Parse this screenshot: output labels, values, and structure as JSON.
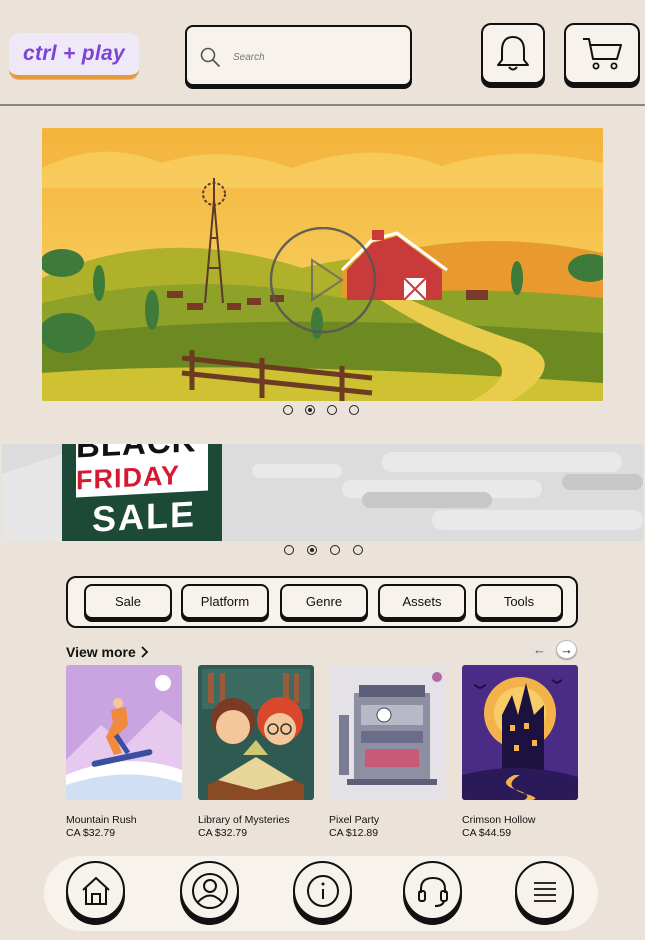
{
  "header": {
    "logo_text": "ctrl + play",
    "search_placeholder": "Search",
    "icons": [
      "search-icon",
      "bell-icon",
      "cart-icon"
    ]
  },
  "hero": {
    "carousel_index": 2,
    "carousel_count": 4,
    "icons": [
      "play-icon"
    ]
  },
  "promo": {
    "line1": "BLACK",
    "line2": "FRIDAY",
    "line3": "SALE",
    "carousel_index": 2,
    "carousel_count": 4
  },
  "filters": [
    "Sale",
    "Platform",
    "Genre",
    "Assets",
    "Tools"
  ],
  "products": {
    "view_more": "View more",
    "items": [
      {
        "name": "Mountain Rush",
        "price": "CA $32.79"
      },
      {
        "name": "Library of Mysteries",
        "price": "CA $32.79"
      },
      {
        "name": "Pixel Party",
        "price": "CA $12.89"
      },
      {
        "name": "Crimson Hollow",
        "price": "CA $44.59"
      }
    ]
  },
  "nav": [
    "home-icon",
    "profile-icon",
    "info-icon",
    "headset-icon",
    "menu-icon"
  ],
  "colors": {
    "background": "#ebe2da",
    "panel": "#f7f2ec",
    "logo_purple": "#7b43d6",
    "logo_underline": "#e69a3a",
    "sale_red": "#d41a33",
    "sale_green": "#1d4a36"
  }
}
